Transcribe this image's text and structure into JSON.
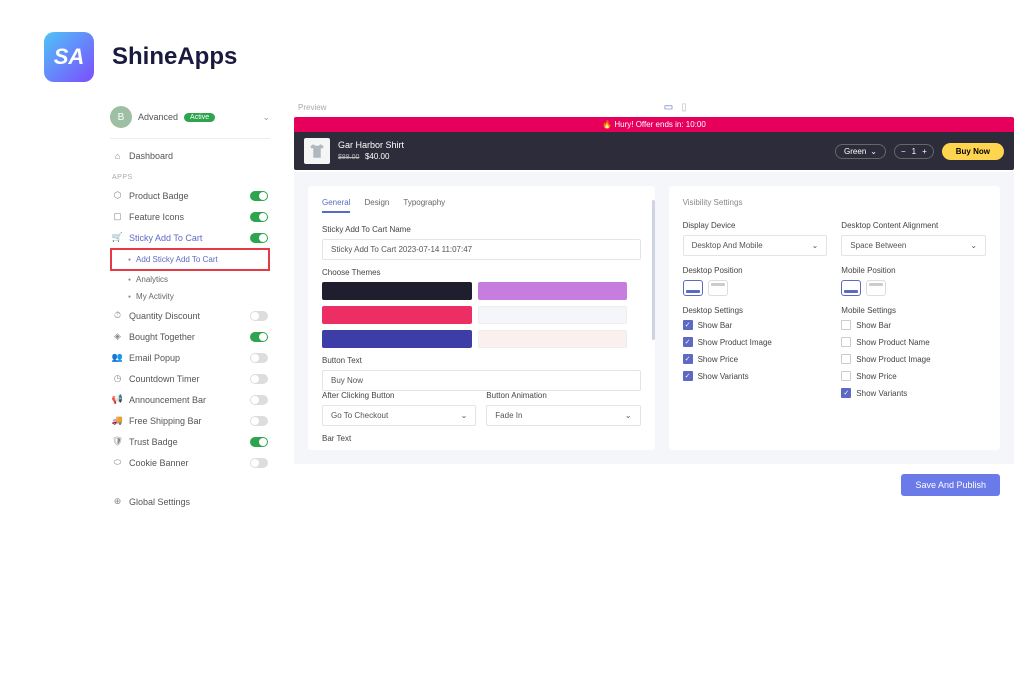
{
  "brand": {
    "name": "ShineApps",
    "logo_text": "SA"
  },
  "account": {
    "initial": "B",
    "plan": "Advanced",
    "status": "Active"
  },
  "nav": {
    "dashboard": "Dashboard",
    "apps_label": "APPS",
    "items": [
      {
        "label": "Product Badge",
        "icon": "⬡",
        "on": true
      },
      {
        "label": "Feature Icons",
        "icon": "▢",
        "on": true
      },
      {
        "label": "Sticky Add To Cart",
        "icon": "🛒",
        "on": true,
        "active": true
      },
      {
        "label": "Quantity Discount",
        "icon": "⏱",
        "on": false
      },
      {
        "label": "Bought Together",
        "icon": "◈",
        "on": true
      },
      {
        "label": "Email Popup",
        "icon": "👥",
        "on": false
      },
      {
        "label": "Countdown Timer",
        "icon": "◷",
        "on": false
      },
      {
        "label": "Announcement Bar",
        "icon": "📢",
        "on": false
      },
      {
        "label": "Free Shipping Bar",
        "icon": "🚚",
        "on": false
      },
      {
        "label": "Trust Badge",
        "icon": "🛡",
        "on": true
      },
      {
        "label": "Cookie Banner",
        "icon": "⬭",
        "on": false
      }
    ],
    "subitems": [
      "Add Sticky Add To Cart",
      "Analytics",
      "My Activity"
    ],
    "global": "Global Settings"
  },
  "preview": {
    "label": "Preview",
    "banner": "🔥 Hury! Offer ends in:   10:00",
    "product": {
      "name": "Gar Harbor Shirt",
      "old_price": "$88.00",
      "new_price": "$40.00"
    },
    "variant": "Green",
    "qty": "1",
    "buy": "Buy Now"
  },
  "general": {
    "tabs": [
      "General",
      "Design",
      "Typography"
    ],
    "name_label": "Sticky Add To Cart Name",
    "name_value": "Sticky Add To Cart 2023-07-14 11:07:47",
    "themes_label": "Choose Themes",
    "themes": [
      "#1e1e2e",
      "#c77dde",
      "#ec2e64",
      "#f5f6fa",
      "#3d3da8",
      "#faf1ee"
    ],
    "button_text_label": "Button Text",
    "button_text_value": "Buy Now",
    "after_click_label": "After Clicking Button",
    "after_click_value": "Go To Checkout",
    "anim_label": "Button Animation",
    "anim_value": "Fade In",
    "bar_text_label": "Bar Text"
  },
  "visibility": {
    "title": "Visibility Settings",
    "display_device_label": "Display Device",
    "display_device_value": "Desktop And Mobile",
    "content_align_label": "Desktop Content Alignment",
    "content_align_value": "Space Between",
    "desktop_pos_label": "Desktop Position",
    "mobile_pos_label": "Mobile Position",
    "desktop_settings_label": "Desktop Settings",
    "mobile_settings_label": "Mobile Settings",
    "desktop_checks": [
      {
        "label": "Show Bar",
        "checked": true
      },
      {
        "label": "Show Product Image",
        "checked": true
      },
      {
        "label": "Show Price",
        "checked": true
      },
      {
        "label": "Show Variants",
        "checked": true
      }
    ],
    "mobile_checks": [
      {
        "label": "Show Bar",
        "checked": false
      },
      {
        "label": "Show Product Name",
        "checked": false
      },
      {
        "label": "Show Product Image",
        "checked": false
      },
      {
        "label": "Show Price",
        "checked": false
      },
      {
        "label": "Show Variants",
        "checked": true
      }
    ]
  },
  "footer": {
    "publish": "Save And Publish"
  }
}
